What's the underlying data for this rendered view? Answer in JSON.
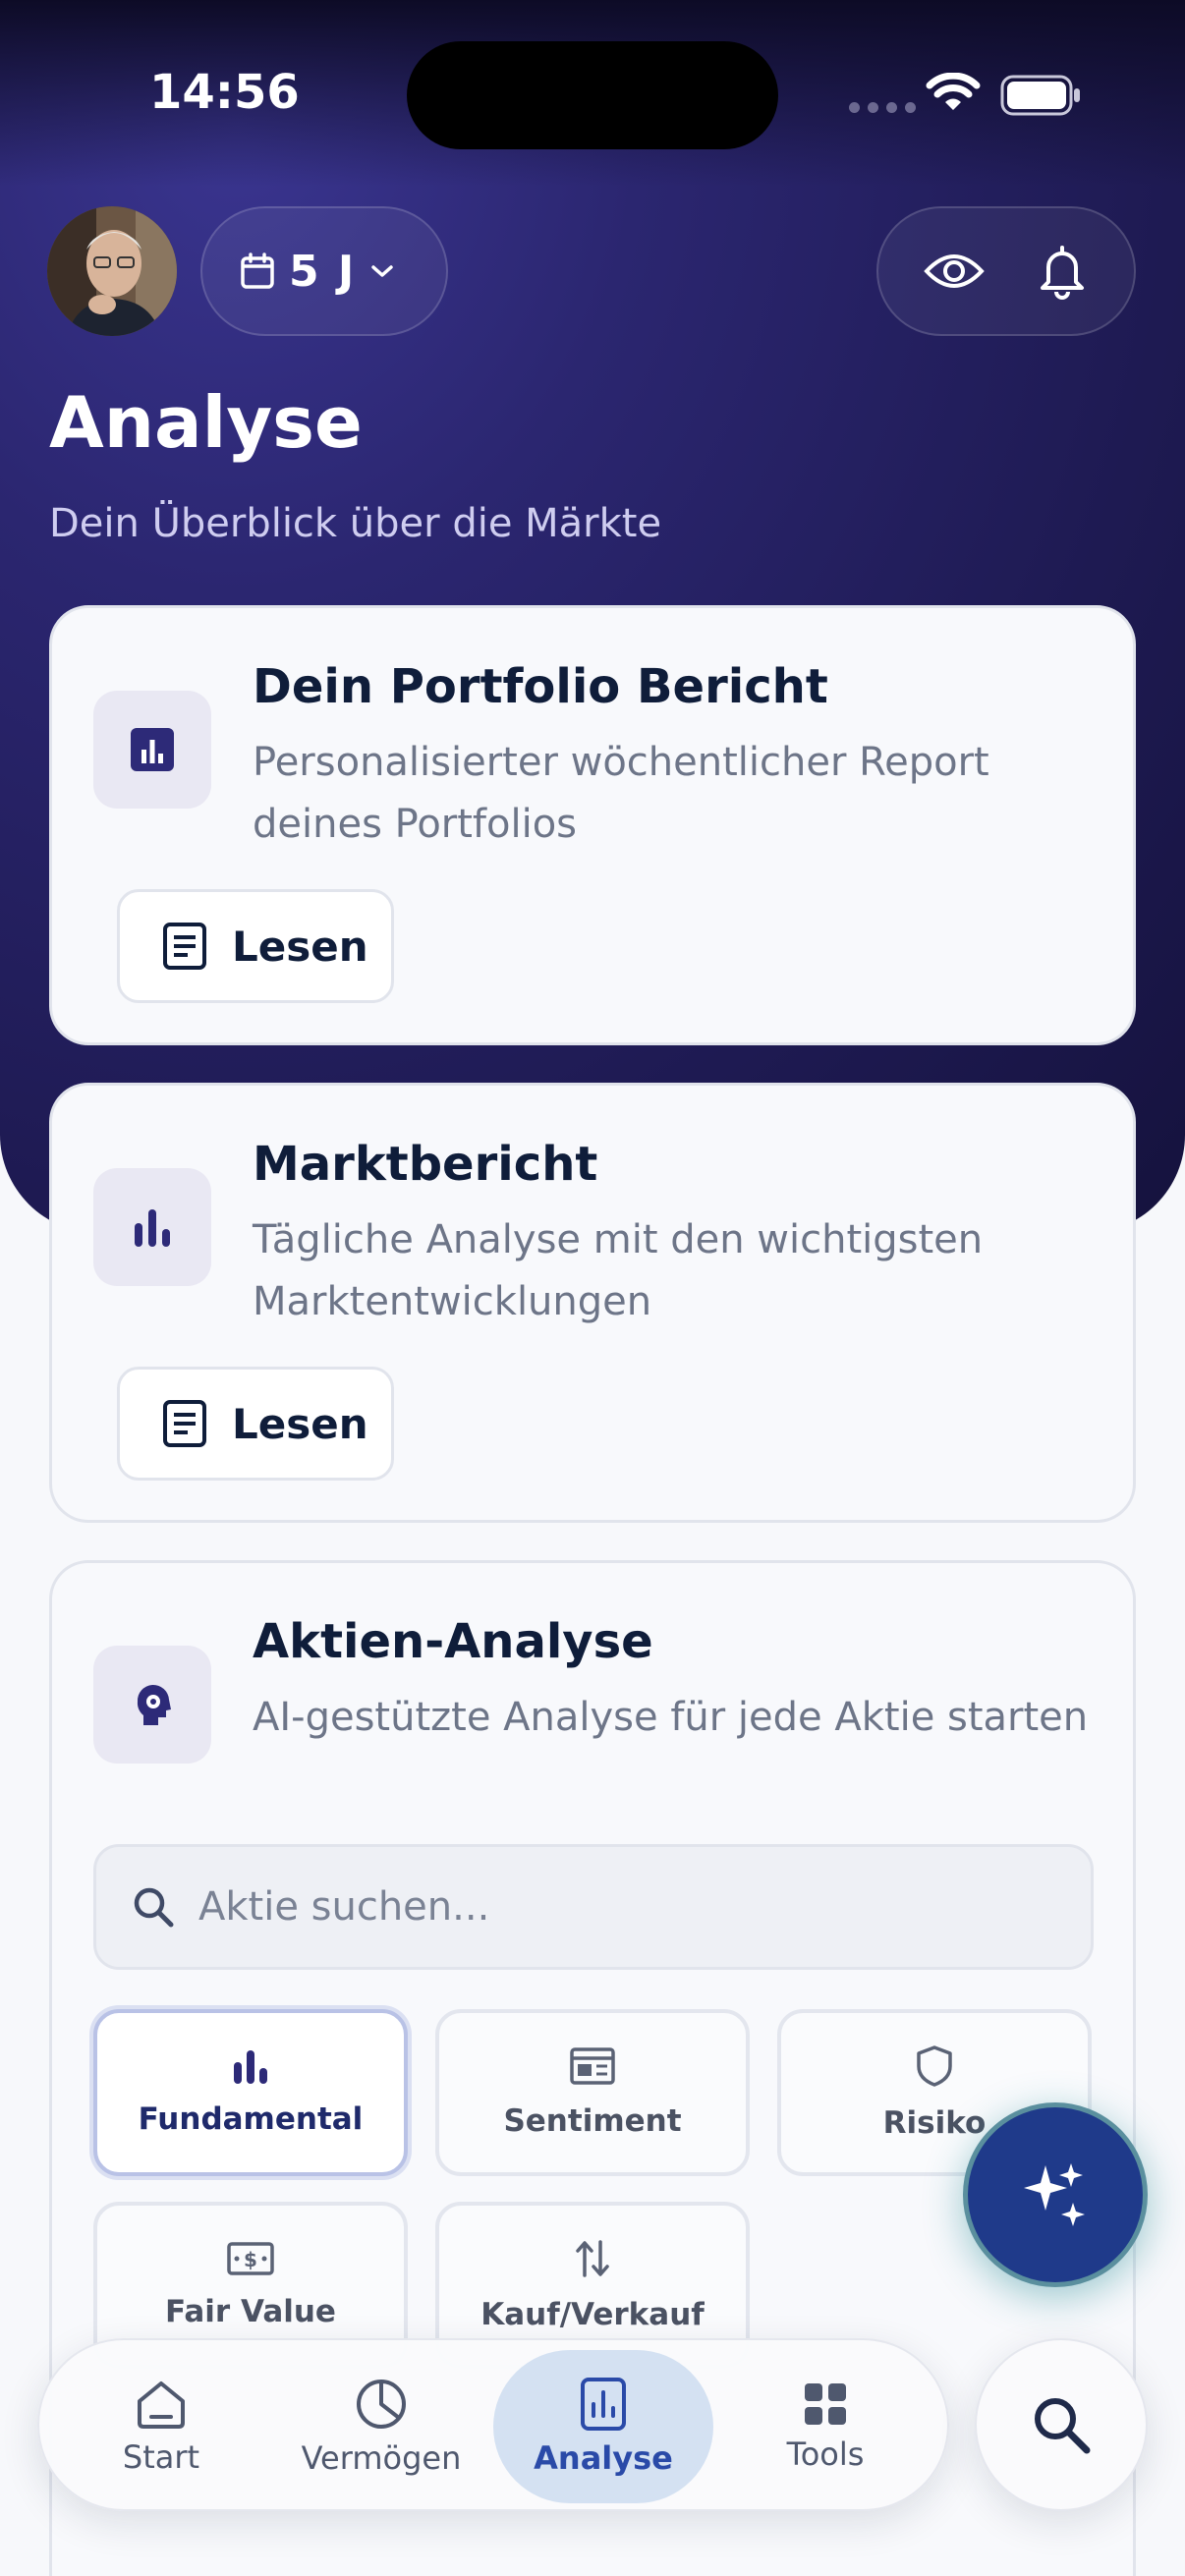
{
  "status_bar": {
    "time": "14:56"
  },
  "header": {
    "period_label": "5 J"
  },
  "page": {
    "title": "Analyse",
    "subtitle": "Dein Überblick über die Märkte"
  },
  "cards": {
    "portfolio": {
      "title": "Dein Portfolio Bericht",
      "description": "Personalisierter wöchentlicher Report deines Portfolios",
      "button_label": "Lesen"
    },
    "market": {
      "title": "Marktbericht",
      "description": "Tägliche Analyse mit den wichtigsten Marktentwicklungen",
      "button_label": "Lesen"
    },
    "stock_analysis": {
      "title": "Aktien-Analyse",
      "description": "AI-gestützte Analyse für jede Aktie starten",
      "search_placeholder": "Aktie suchen...",
      "tiles": [
        "Fundamental",
        "Sentiment",
        "Risiko",
        "Fair Value",
        "Kauf/Verkauf"
      ],
      "active_tile": "Fundamental"
    }
  },
  "tabbar": {
    "tabs": [
      "Start",
      "Vermögen",
      "Analyse",
      "Tools"
    ],
    "active": "Analyse"
  },
  "colors": {
    "hero_bg": "#2b2670",
    "accent": "#2a4aa8",
    "fab": "#1f3a8a",
    "active_tab_bg": "#d4e1f2"
  }
}
